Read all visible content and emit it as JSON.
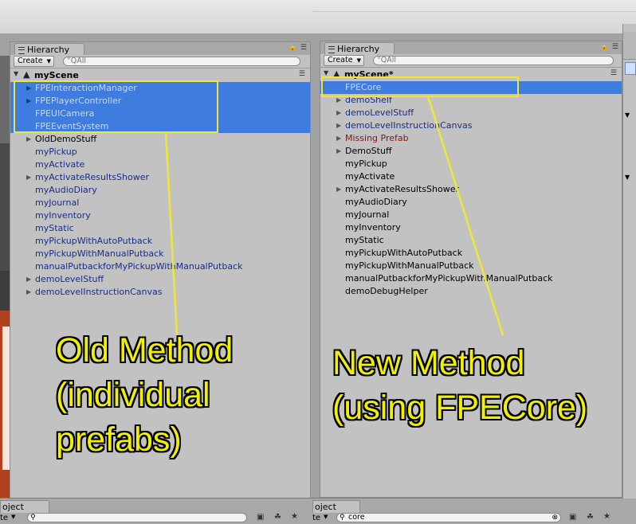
{
  "colors": {
    "selection": "#3e7ce0",
    "annotation": "#f0f000",
    "panel": "#c2c2c2",
    "prefab_text": "#1a2d86",
    "missing_prefab": "#7a1a1a"
  },
  "left": {
    "tab_label": "Hierarchy",
    "create_label": "Create",
    "search_placeholder": "°QAll",
    "scene_name": "myScene",
    "items": [
      {
        "label": "FPEInteractionManager",
        "selected": true,
        "expand": true,
        "style": "sel"
      },
      {
        "label": "FPEPlayerController",
        "selected": true,
        "expand": true,
        "style": "sel"
      },
      {
        "label": "FPEUICamera",
        "selected": true,
        "expand": false,
        "style": "sel"
      },
      {
        "label": "FPEEventSystem",
        "selected": true,
        "expand": false,
        "style": "sel"
      },
      {
        "label": "OldDemoStuff",
        "selected": false,
        "expand": true,
        "style": "blk"
      },
      {
        "label": "myPickup",
        "selected": false,
        "expand": false,
        "style": "blue"
      },
      {
        "label": "myActivate",
        "selected": false,
        "expand": false,
        "style": "blue"
      },
      {
        "label": "myActivateResultsShower",
        "selected": false,
        "expand": true,
        "style": "blue"
      },
      {
        "label": "myAudioDiary",
        "selected": false,
        "expand": false,
        "style": "blue"
      },
      {
        "label": "myJournal",
        "selected": false,
        "expand": false,
        "style": "blue"
      },
      {
        "label": "myInventory",
        "selected": false,
        "expand": false,
        "style": "blue"
      },
      {
        "label": "myStatic",
        "selected": false,
        "expand": false,
        "style": "blue"
      },
      {
        "label": "myPickupWithAutoPutback",
        "selected": false,
        "expand": false,
        "style": "blue"
      },
      {
        "label": "myPickupWithManualPutback",
        "selected": false,
        "expand": false,
        "style": "blue"
      },
      {
        "label": "manualPutbackforMyPickupWithManualPutback",
        "selected": false,
        "expand": false,
        "style": "blue"
      },
      {
        "label": "demoLevelStuff",
        "selected": false,
        "expand": true,
        "style": "blue"
      },
      {
        "label": "demoLevelInstructionCanvas",
        "selected": false,
        "expand": true,
        "style": "blue"
      }
    ],
    "bottom_tab": "oject",
    "bottom_search_left": "te",
    "annotation": "Old Method\n(individual\nprefabs)"
  },
  "right": {
    "tab_label": "Hierarchy",
    "create_label": "Create",
    "search_placeholder": "°QAll",
    "scene_name": "myScene*",
    "items": [
      {
        "label": "FPECore",
        "selected": true,
        "expand": false,
        "style": "sel"
      },
      {
        "label": "demoShelf",
        "selected": false,
        "expand": true,
        "style": "blue"
      },
      {
        "label": "demoLevelStuff",
        "selected": false,
        "expand": true,
        "style": "blue"
      },
      {
        "label": "demoLevelInstructionCanvas",
        "selected": false,
        "expand": true,
        "style": "blue"
      },
      {
        "label": "Missing Prefab",
        "selected": false,
        "expand": true,
        "style": "red"
      },
      {
        "label": "DemoStuff",
        "selected": false,
        "expand": true,
        "style": "blk"
      },
      {
        "label": "myPickup",
        "selected": false,
        "expand": false,
        "style": "blk"
      },
      {
        "label": "myActivate",
        "selected": false,
        "expand": false,
        "style": "blk"
      },
      {
        "label": "myActivateResultsShower",
        "selected": false,
        "expand": true,
        "style": "blk"
      },
      {
        "label": "myAudioDiary",
        "selected": false,
        "expand": false,
        "style": "blk"
      },
      {
        "label": "myJournal",
        "selected": false,
        "expand": false,
        "style": "blk"
      },
      {
        "label": "myInventory",
        "selected": false,
        "expand": false,
        "style": "blk"
      },
      {
        "label": "myStatic",
        "selected": false,
        "expand": false,
        "style": "blk"
      },
      {
        "label": "myPickupWithAutoPutback",
        "selected": false,
        "expand": false,
        "style": "blk"
      },
      {
        "label": "myPickupWithManualPutback",
        "selected": false,
        "expand": false,
        "style": "blk"
      },
      {
        "label": "manualPutbackforMyPickupWithManualPutback",
        "selected": false,
        "expand": false,
        "style": "blk"
      },
      {
        "label": "demoDebugHelper",
        "selected": false,
        "expand": false,
        "style": "blk"
      }
    ],
    "bottom_tab": "oject",
    "bottom_search_left": "te",
    "bottom_search_value": "core",
    "annotation": "New Method\n(using FPECore)"
  }
}
